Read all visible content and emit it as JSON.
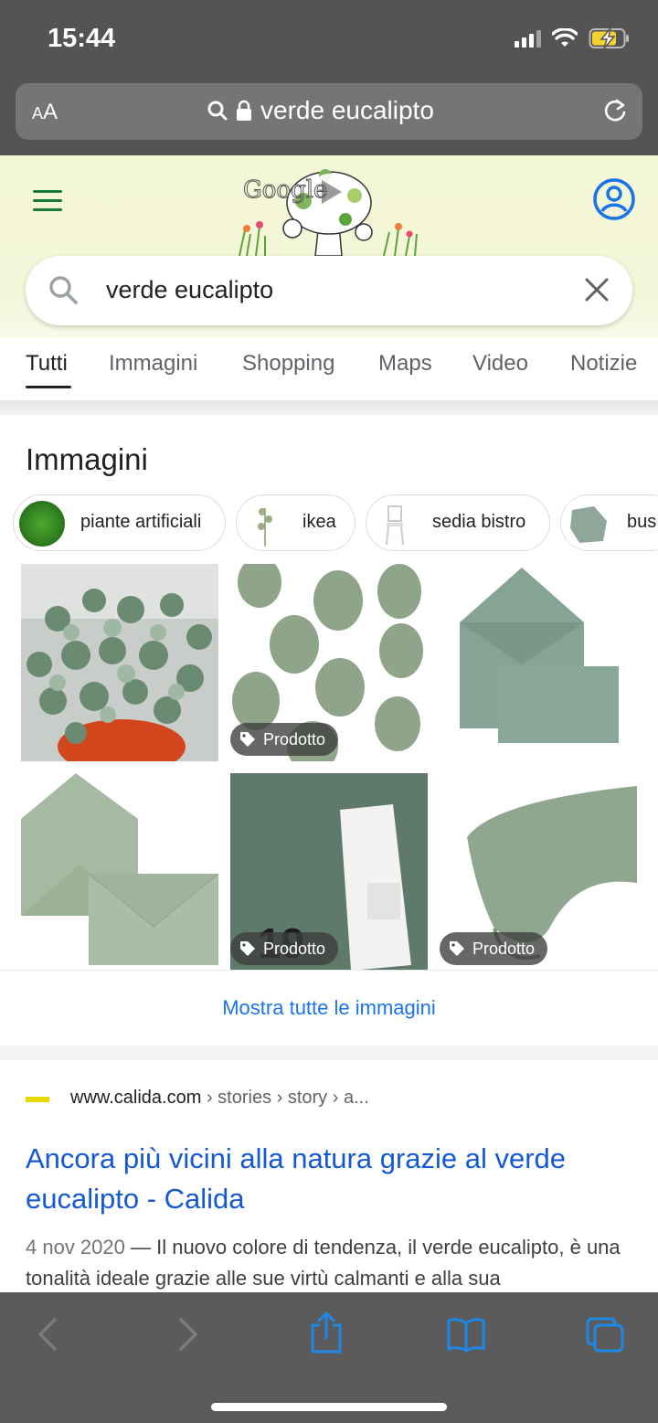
{
  "status_bar": {
    "time": "15:44"
  },
  "safari": {
    "aa_label": "AA",
    "url_text": "verde eucalipto"
  },
  "google": {
    "logo_letters": "Google",
    "search_query": "verde eucalipto",
    "tabs": [
      {
        "label": "Tutti",
        "active": true
      },
      {
        "label": "Immagini"
      },
      {
        "label": "Shopping"
      },
      {
        "label": "Maps"
      },
      {
        "label": "Video"
      },
      {
        "label": "Notizie"
      }
    ]
  },
  "images": {
    "title": "Immagini",
    "chips": [
      {
        "label": "piante artificiali"
      },
      {
        "label": "ikea"
      },
      {
        "label": "sedia bistro"
      },
      {
        "label": "bus"
      }
    ],
    "badge_label": "Prodotto",
    "show_all": "Mostra tutte le immagini"
  },
  "result": {
    "domain": "www.calida.com",
    "path": " › stories › story › a...",
    "title": "Ancora più vicini alla natura grazie al verde eucalipto - Calida",
    "date": "4 nov 2020",
    "snippet": " — Il nuovo colore di tendenza, il verde eucalipto, è una tonalità ideale grazie alle sue virtù calmanti e alla sua"
  },
  "colors": {
    "link_blue": "#1558d6",
    "accent_blue": "#1a73e8",
    "safari_gray": "#545454",
    "eucalyptus_green": "#8ea58a"
  }
}
